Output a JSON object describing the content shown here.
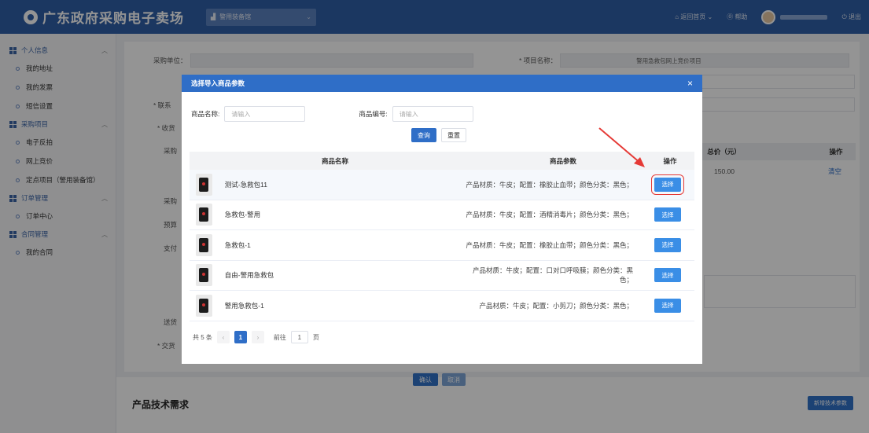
{
  "header": {
    "site_title": "广东政府采购电子卖场",
    "store_select": "警用装备馆",
    "home_link": "返回首页",
    "help_link": "帮助",
    "logout_link": "退出"
  },
  "sidebar": {
    "sections": [
      {
        "title": "个人信息",
        "items": [
          "我的地址",
          "我的发票",
          "短信设置"
        ]
      },
      {
        "title": "采购项目",
        "items": [
          "电子反拍",
          "网上竞价",
          "定点项目（警用装备馆）"
        ]
      },
      {
        "title": "订单管理",
        "items": [
          "订单中心"
        ]
      },
      {
        "title": "合同管理",
        "items": [
          "我的合同"
        ]
      }
    ]
  },
  "background_form": {
    "purchaser_label": "采购单位：",
    "project_label": "* 项目名称：",
    "project_value": "警用急救包网上竞价项目",
    "contact_label": "* 联系",
    "receive_label": "* 收货",
    "purchase_label": "采购",
    "purchase2_label": "采购",
    "budget_label": "预算",
    "pay_label": "支付",
    "delivery_label": "送货",
    "trade_label": "* 交货",
    "total_header": "总价（元）",
    "op_header": "操作",
    "total_value": "150.00",
    "clear_link": "清空",
    "confirm_btn": "确认",
    "cancel_btn": "取消",
    "tech_title": "产品技术需求",
    "add_tech_btn": "新增技术参数"
  },
  "modal": {
    "title": "选择导入商品参数",
    "name_label": "商品名称:",
    "name_placeholder": "请输入",
    "code_label": "商品编号:",
    "code_placeholder": "请输入",
    "query_btn": "查询",
    "reset_btn": "重置",
    "columns": [
      "商品名称",
      "商品参数",
      "操作"
    ],
    "select_label": "选择",
    "rows": [
      {
        "name": "测试-急救包11",
        "params": "产品材质：牛皮；配置：橡胶止血带；颜色分类：黑色；"
      },
      {
        "name": "急救包-警用",
        "params": "产品材质：牛皮；配置：酒精消毒片；颜色分类：黑色；"
      },
      {
        "name": "急救包-1",
        "params": "产品材质：牛皮；配置：橡胶止血带；颜色分类：黑色；"
      },
      {
        "name": "自由-警用急救包",
        "params": "产品材质：牛皮；配置：口对口呼吸膜；颜色分类：黑色；"
      },
      {
        "name": "警用急救包-1",
        "params": "产品材质：牛皮；配置：小剪刀；颜色分类：黑色；"
      }
    ],
    "pager": {
      "total": "共 5 条",
      "current": "1",
      "goto_label": "前往",
      "goto_value": "1",
      "page_unit": "页"
    }
  },
  "colors": {
    "header_bg": "#2f5fa8",
    "primary": "#2f6ec7",
    "select_btn": "#3a8ee6",
    "highlight": "#e53935"
  }
}
